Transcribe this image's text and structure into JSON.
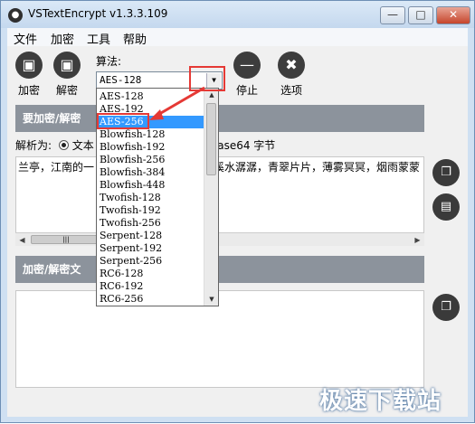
{
  "window": {
    "title": "VSTextEncrypt v1.3.3.109"
  },
  "menu": [
    "文件",
    "加密",
    "工具",
    "帮助"
  ],
  "toolbar": {
    "encrypt_label": "加密",
    "decrypt_label": "解密",
    "stop_label": "停止",
    "options_label": "选项",
    "algo_label": "算法:",
    "algo_value": "AES-128"
  },
  "section1": {
    "header": "要加密/解密"
  },
  "parse": {
    "label": "解析为:",
    "opt_text": "文本",
    "base64_label": "Base64 字节"
  },
  "input_text": {
    "line1": "兰亭，江南的一",
    "line1_suffix": "溪水潺潺，青翠片片，薄雾冥冥，烟雨蒙蒙"
  },
  "section2": {
    "header": "加密/解密文"
  },
  "dropdown": {
    "items": [
      "AES-128",
      "AES-192",
      "AES-256",
      "Blowfish-128",
      "Blowfish-192",
      "Blowfish-256",
      "Blowfish-384",
      "Blowfish-448",
      "Twofish-128",
      "Twofish-192",
      "Twofish-256",
      "Serpent-128",
      "Serpent-192",
      "Serpent-256",
      "RC6-128",
      "RC6-192",
      "RC6-256"
    ],
    "selected_index": 2
  },
  "watermark": "极速下载站"
}
